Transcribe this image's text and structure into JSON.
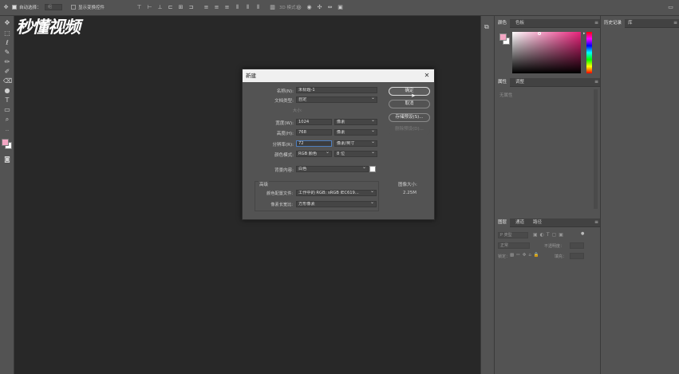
{
  "options_bar": {
    "auto_select_label": "自动选择：",
    "auto_select_value": "组",
    "show_transform_label": "显示变换控件",
    "mode_3d_label": "3D 模式："
  },
  "watermark": "秒懂视频",
  "tools": [
    "move-icon",
    "marquee-icon",
    "lasso-icon",
    "quick-select-icon",
    "crop-icon",
    "eyedropper-icon",
    "healing-brush-icon",
    "brush-icon",
    "stamp-icon",
    "eraser-icon",
    "gradient-icon",
    "dodge-icon",
    "pen-icon",
    "type-icon",
    "path-select-icon",
    "shape-icon",
    "hand-icon",
    "zoom-icon"
  ],
  "colors": {
    "foreground": "#f4a7c4",
    "background": "#ffffff",
    "accent_blue": "#4f7fbf"
  },
  "color_panel": {
    "tabs": [
      "颜色",
      "色板"
    ]
  },
  "history_panel": {
    "tabs": [
      "历史记录",
      "库"
    ]
  },
  "properties_panel": {
    "tabs": [
      "属性",
      "调整"
    ],
    "empty_text": "无属性"
  },
  "layers_panel": {
    "tabs": [
      "图层",
      "通道",
      "路径"
    ],
    "kind_label": "P 类型",
    "blend_mode": "正常",
    "opacity_label": "不透明度：",
    "lock_label": "锁定：",
    "fill_label": "填充："
  },
  "dialog": {
    "title": "新建",
    "name_label": "名称(N):",
    "name_value": "未标题-1",
    "preset_label": "文档类型:",
    "preset_value": "自定",
    "size_label": "大小:",
    "width_label": "宽度(W):",
    "width_value": "1024",
    "width_unit": "像素",
    "height_label": "高度(H):",
    "height_value": "768",
    "height_unit": "像素",
    "resolution_label": "分辨率(R):",
    "resolution_value": "72",
    "resolution_unit": "像素/英寸",
    "color_mode_label": "颜色模式:",
    "color_mode_value": "RGB 颜色",
    "bit_depth_value": "8 位",
    "background_label": "背景内容:",
    "background_value": "白色",
    "advanced_label": "高级",
    "color_profile_label": "颜色配置文件:",
    "color_profile_value": "工作中的 RGB: sRGB IEC619...",
    "pixel_aspect_label": "像素长宽比:",
    "pixel_aspect_value": "方形像素",
    "image_size_label": "图像大小:",
    "image_size_value": "2.25M",
    "ok_label": "确定",
    "cancel_label": "取消",
    "save_preset_label": "存储预设(S)...",
    "delete_preset_label": "删除预设(D)..."
  }
}
